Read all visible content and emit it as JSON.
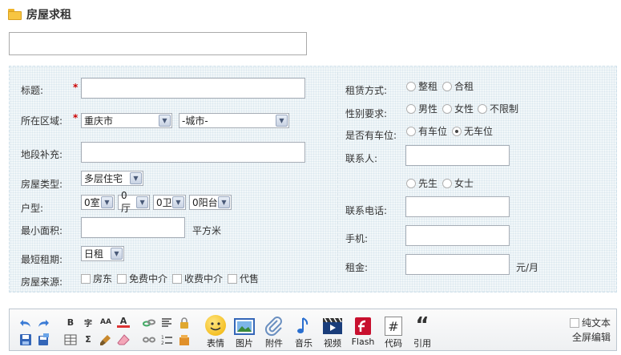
{
  "header": {
    "title": "房屋求租"
  },
  "form": {
    "title_label": "标题:",
    "region_label": "所在区域:",
    "region_city": "重庆市",
    "region_district": "-城市-",
    "address_label": "地段补充:",
    "house_type_label": "房屋类型:",
    "house_type_value": "多层住宅",
    "layout_label": "户型:",
    "rooms": "0室",
    "halls": "0厅",
    "baths": "0卫",
    "balconies": "0阳台",
    "min_area_label": "最小面积:",
    "area_unit": "平方米",
    "min_term_label": "最短租期:",
    "term_value": "日租",
    "source_label": "房屋来源:",
    "sources": [
      "房东",
      "免费中介",
      "收费中介",
      "代售"
    ],
    "lease_label": "租赁方式:",
    "lease_options": [
      "整租",
      "合租"
    ],
    "gender_label": "性别要求:",
    "gender_options": [
      "男性",
      "女性",
      "不限制"
    ],
    "parking_label": "是否有车位:",
    "parking_options": [
      "有车位",
      "无车位"
    ],
    "contact_label": "联系人:",
    "salutation_options": [
      "先生",
      "女士"
    ],
    "phone_label": "联系电话:",
    "mobile_label": "手机:",
    "rent_label": "租金:",
    "rent_unit": "元/月"
  },
  "toolbar": {
    "emoji": "表情",
    "image": "图片",
    "attachment": "附件",
    "music": "音乐",
    "video": "视频",
    "flash": "Flash",
    "code": "代码",
    "quote": "引用",
    "plain_text": "纯文本",
    "fullscreen": "全屏编辑",
    "bold_glyph": "B",
    "font_glyph": "字",
    "size_glyph": "AA",
    "color_glyph": "A",
    "sigma_glyph": "Σ",
    "hash_glyph": "#",
    "quote_glyph": "“"
  }
}
